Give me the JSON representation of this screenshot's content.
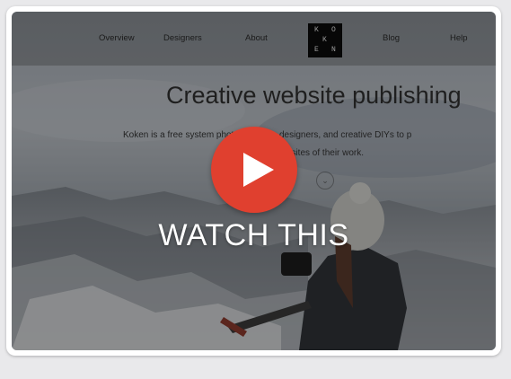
{
  "nav": {
    "items": [
      "Overview",
      "Designers",
      "About",
      "Blog",
      "Help"
    ],
    "logo_letters": [
      "K",
      "O",
      "K",
      "E",
      "N"
    ]
  },
  "hero": {
    "title": "Creative website publishing",
    "subtitle_line1": "Koken is a free system          photographers, designers, and creative DIYs to p",
    "subtitle_line2": "nt websites of their work.",
    "scroll_icon": "chevron-down-icon"
  },
  "overlay": {
    "label": "WATCH THIS",
    "play_icon": "play-icon",
    "play_color": "#e0402f"
  },
  "colors": {
    "page_bg": "#e9e9eb",
    "card_bg": "#ffffff",
    "label": "#ffffff"
  }
}
